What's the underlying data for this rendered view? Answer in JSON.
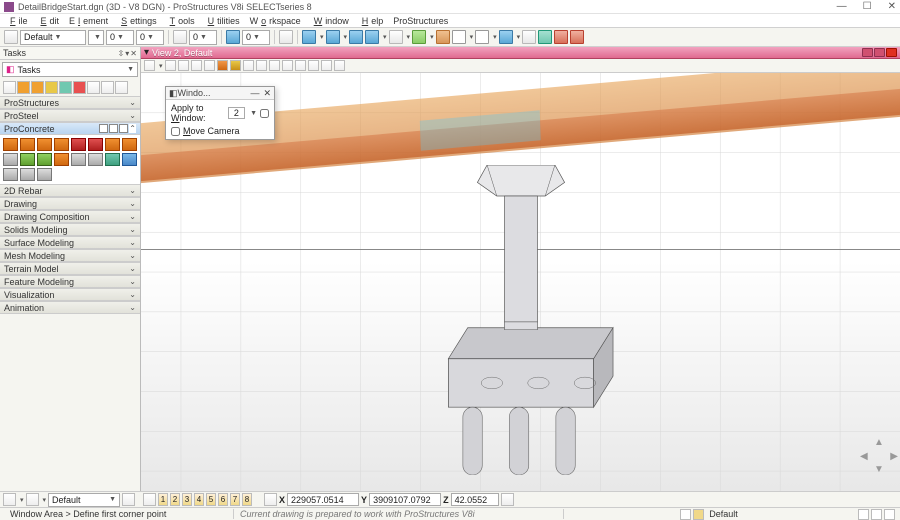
{
  "app": {
    "title": "DetailBridgeStart.dgn (3D - V8 DGN) - ProStructures V8i SELECTseries 8",
    "attr_combo": "Default"
  },
  "menu": {
    "file": "File",
    "edit": "Edit",
    "element": "Element",
    "settings": "Settings",
    "tools": "Tools",
    "utilities": "Utilities",
    "workspace": "Workspace",
    "window": "Window",
    "help": "Help",
    "prostructures": "ProStructures"
  },
  "tasks": {
    "header": "Tasks",
    "combo": "Tasks",
    "sections": {
      "prostructures": "ProStructures",
      "prosteel": "ProSteel",
      "proconcrete": "ProConcrete",
      "rebar2d": "2D Rebar",
      "drawing": "Drawing",
      "drawing_comp": "Drawing Composition",
      "solids": "Solids Modeling",
      "surface": "Surface Modeling",
      "mesh": "Mesh Modeling",
      "terrain": "Terrain Model",
      "feature": "Feature Modeling",
      "visualization": "Visualization",
      "animation": "Animation"
    }
  },
  "view": {
    "title": "View 2, Default"
  },
  "popup": {
    "title": "Windo...",
    "apply_label": "Apply to Window:",
    "apply_value": "2",
    "move_camera": "Move Camera"
  },
  "bottombar": {
    "level_combo": "Default",
    "num_buttons": [
      "1",
      "2",
      "3",
      "4",
      "5",
      "6",
      "7",
      "8"
    ],
    "x_label": "X",
    "x_val": "229057.0514",
    "y_label": "Y",
    "y_val": "3909107.0792",
    "z_label": "Z",
    "z_val": "42.0552"
  },
  "status": {
    "left": "Window Area > Define first corner point",
    "mid": "Current drawing is prepared to work with ProStructures V8i",
    "right_combo": "Default"
  }
}
